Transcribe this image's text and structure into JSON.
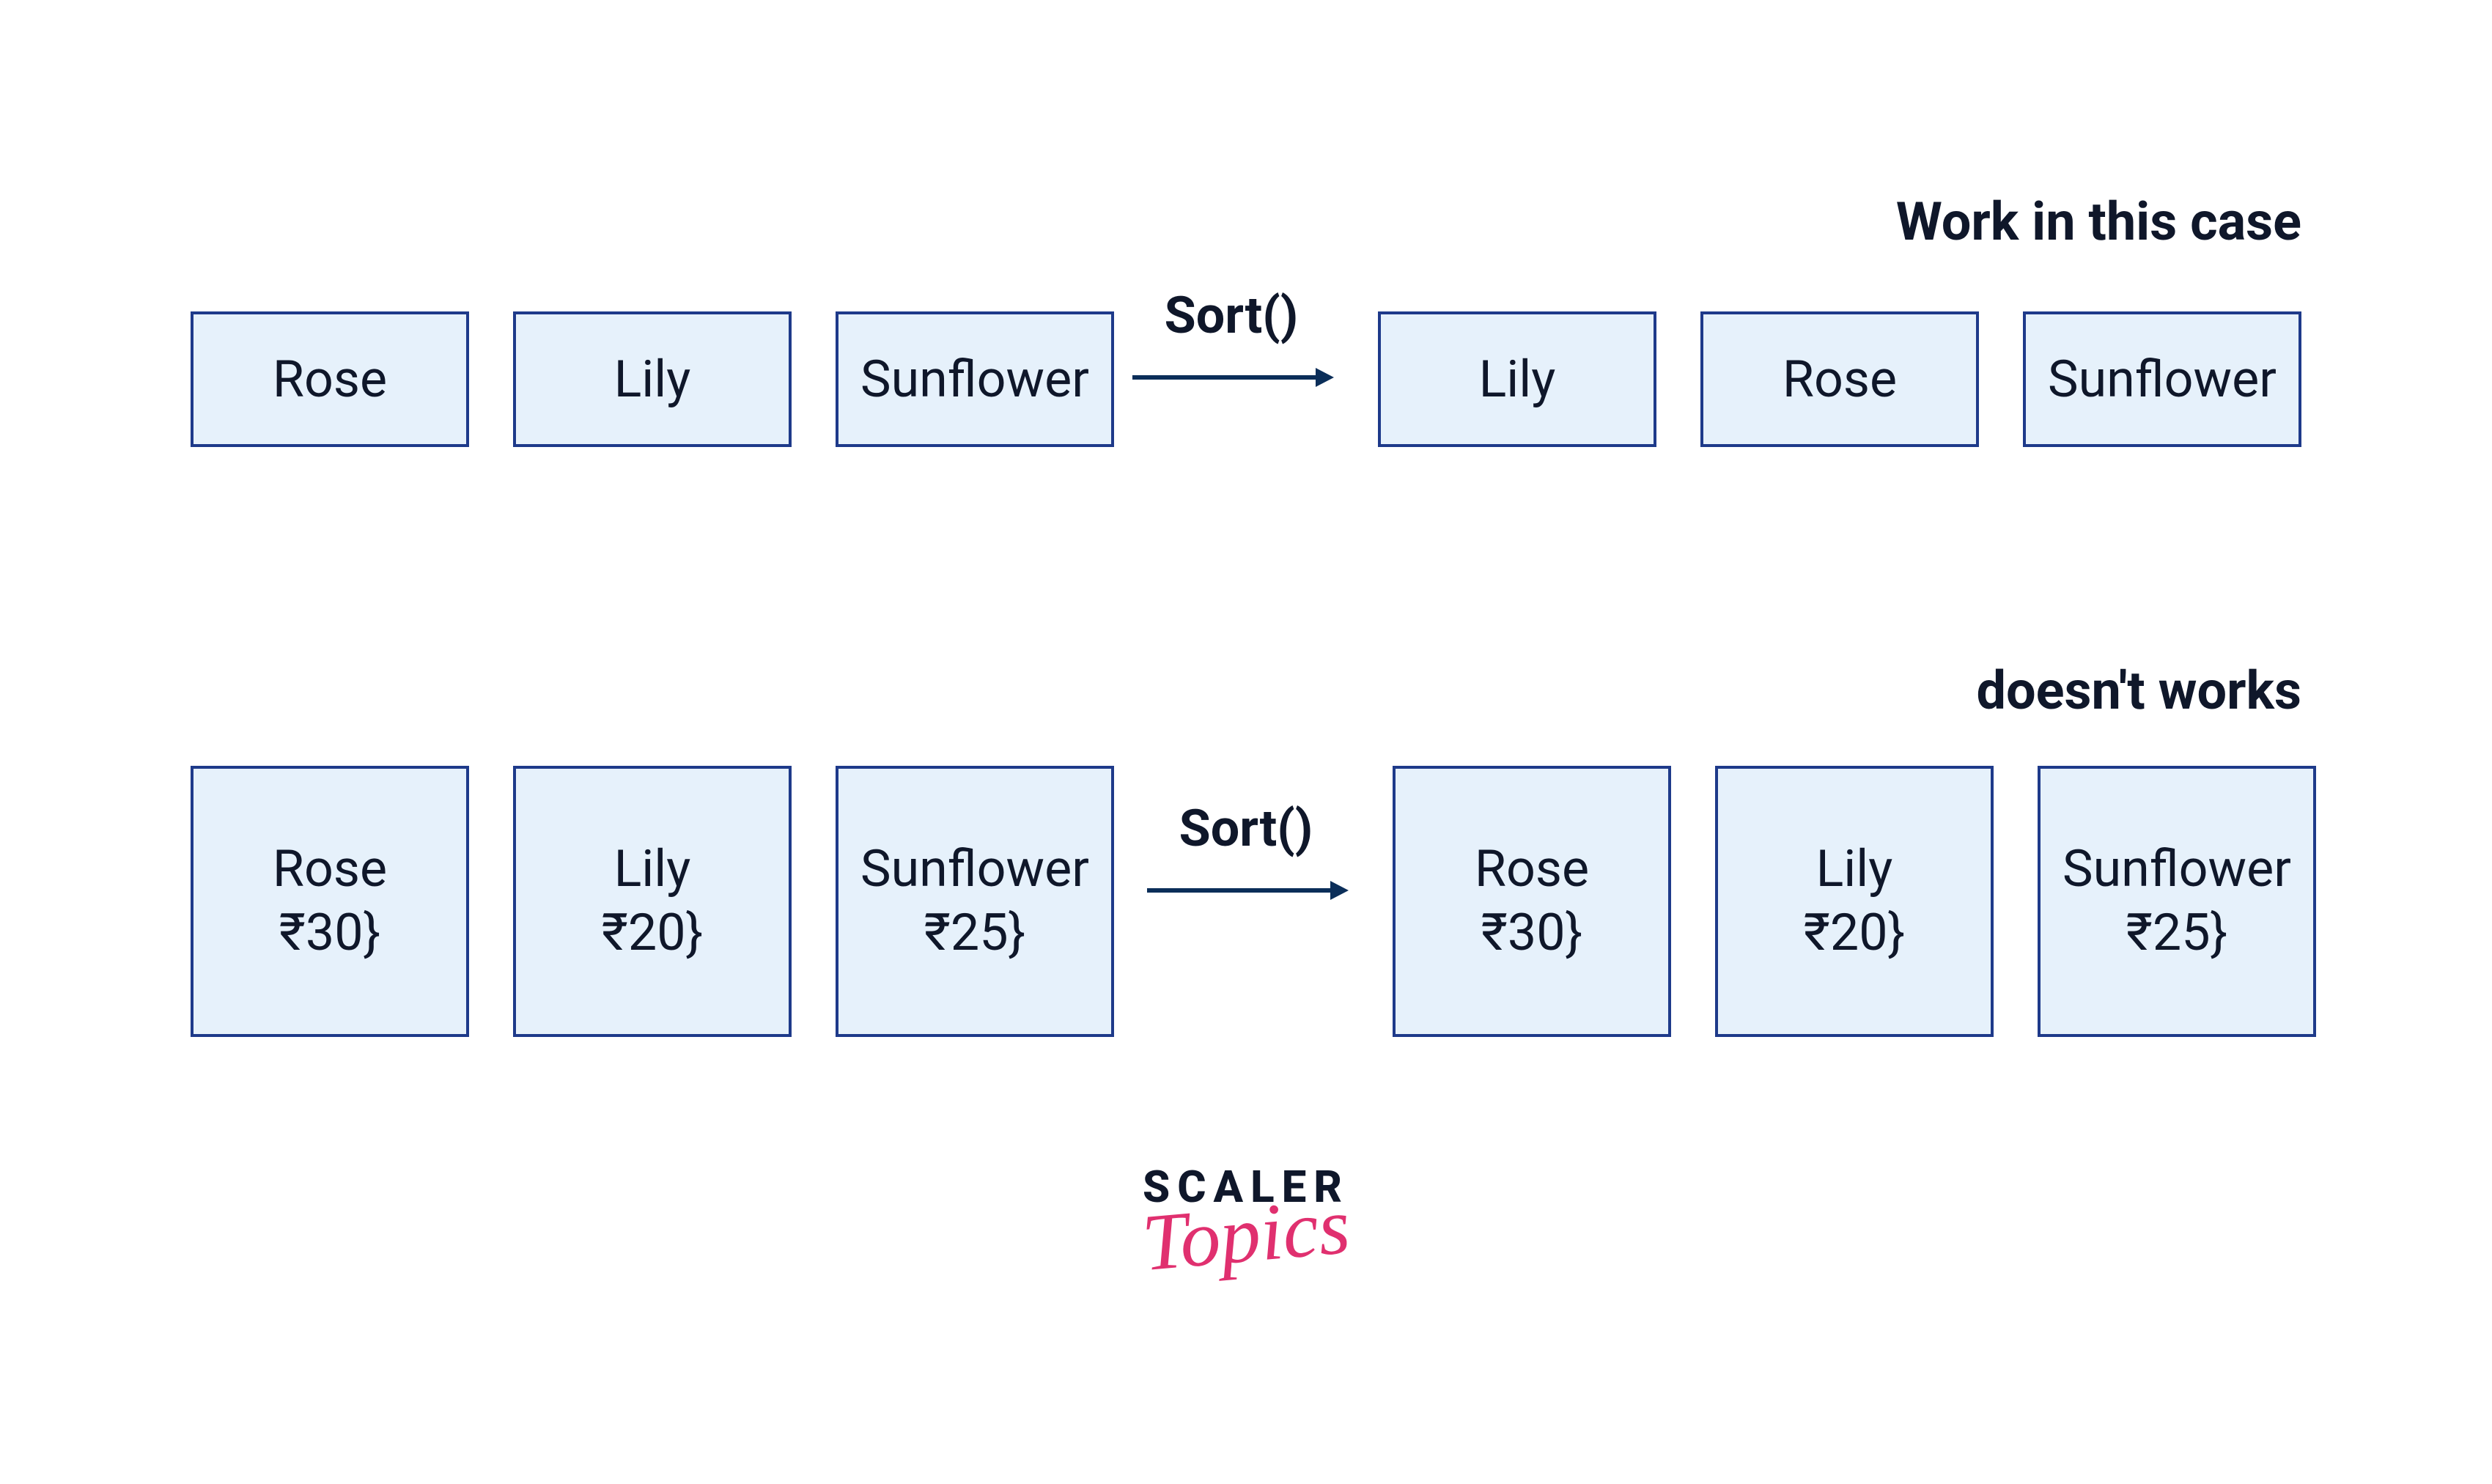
{
  "caption1": "Work in this case",
  "caption2": "doesn't works",
  "sortLabel": "Sort()",
  "row1": {
    "input": [
      "Rose",
      "Lily",
      "Sunflower"
    ],
    "output": [
      "Lily",
      "Rose",
      "Sunflower"
    ]
  },
  "row2": {
    "input": [
      {
        "name": "Rose",
        "price": "₹30}"
      },
      {
        "name": "Lily",
        "price": "₹20}"
      },
      {
        "name": "Sunflower",
        "price": "₹25}"
      }
    ],
    "output": [
      {
        "name": "Rose",
        "price": "₹30}"
      },
      {
        "name": "Lily",
        "price": "₹20}"
      },
      {
        "name": "Sunflower",
        "price": "₹25}"
      }
    ]
  },
  "logo": {
    "line1": "SCALER",
    "line2": "Topics"
  },
  "colors": {
    "boxBorder": "#1e3a8a",
    "boxFill": "#e6f1fb",
    "arrow": "#0b2e59",
    "logoAccent": "#e0306f"
  }
}
